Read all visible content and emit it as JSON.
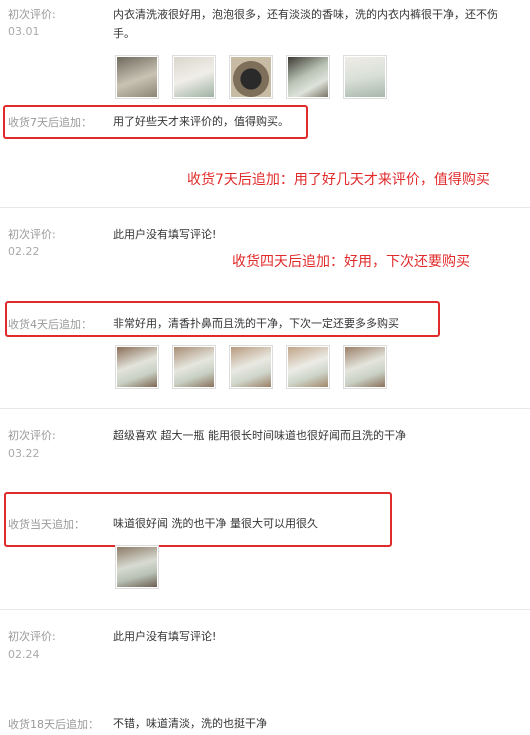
{
  "reviews": [
    {
      "initial_label": "初次评价:",
      "date": "03.01",
      "initial_text": "内衣清洗液很好用，泡泡很多，还有淡淡的香味，洗的内衣内裤很干净，还不伤手。",
      "append_label": "收货7天后追加：",
      "append_text": "用了好些天才来评价的，值得购买。",
      "annotation": "收货7天后追加：用了好几天才来评价，值得购买",
      "photos": [
        "product-photo-1",
        "product-photo-2",
        "product-photo-3",
        "product-photo-4",
        "product-photo-5"
      ]
    },
    {
      "initial_label": "初次评价:",
      "date": "02.22",
      "initial_text": "此用户没有填写评论!",
      "append_label": "收货4天后追加：",
      "append_text": "非常好用，清香扑鼻而且洗的干净，下次一定还要多多购买",
      "annotation": "收货四天后追加：好用，下次还要购买",
      "photos": [
        "product-photo-1",
        "product-photo-2",
        "product-photo-3",
        "product-photo-4",
        "product-photo-5"
      ]
    },
    {
      "initial_label": "初次评价:",
      "date": "03.22",
      "initial_text": "超级喜欢 超大一瓶 能用很长时间味道也很好闻而且洗的干净",
      "append_label": "收货当天追加：",
      "append_text": "味道很好闻 洗的也干净 量很大可以用很久",
      "photos": [
        "product-photo-1"
      ]
    },
    {
      "initial_label": "初次评价:",
      "date": "02.24",
      "initial_text": "此用户没有填写评论!",
      "append_label": "收货18天后追加：",
      "append_text": "不错，味道清淡，洗的也挺干净"
    }
  ],
  "colors": {
    "annotation_red": "#e12b2b",
    "label_gray": "#999999",
    "divider": "#e8e8e8"
  }
}
